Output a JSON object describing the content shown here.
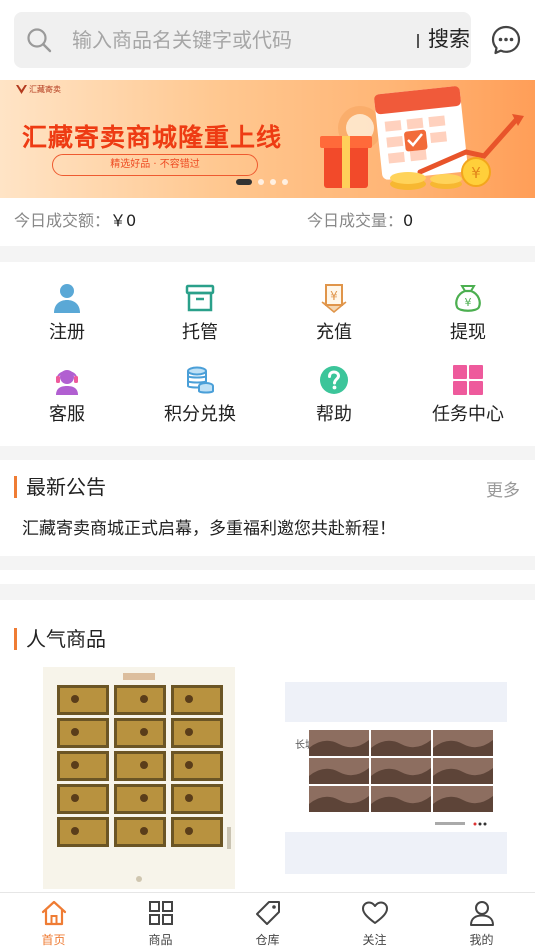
{
  "search": {
    "placeholder": "输入商品名关键字或代码",
    "button_label": "搜索",
    "icon": "search-icon",
    "message_icon": "chat-bubble-icon"
  },
  "banner": {
    "logo_text": "汇藏寄卖",
    "title": "汇藏寄卖商城隆重上线",
    "subtitle": "精选好品 · 不容错过",
    "slides_count": 4,
    "active_slide": 1
  },
  "stats": {
    "turnover_label": "今日成交额：",
    "turnover_value": "￥0",
    "volume_label": "今日成交量：",
    "volume_value": "0"
  },
  "menu": {
    "items": [
      {
        "label": "注册",
        "icon": "user-icon",
        "color": "#5aa8d6"
      },
      {
        "label": "托管",
        "icon": "archive-box-icon",
        "color": "#2aa08a"
      },
      {
        "label": "充值",
        "icon": "yen-envelope-icon",
        "color": "#e0954a"
      },
      {
        "label": "提现",
        "icon": "money-bag-icon",
        "color": "#4caf50"
      },
      {
        "label": "客服",
        "icon": "headset-agent-icon",
        "color": "#b15fd1"
      },
      {
        "label": "积分兑换",
        "icon": "coin-stack-icon",
        "color": "#4a9fd8"
      },
      {
        "label": "帮助",
        "icon": "question-circle-icon",
        "color": "#3cc59a"
      },
      {
        "label": "任务中心",
        "icon": "grid-tiles-icon",
        "color": "#ee5a9c"
      }
    ]
  },
  "notice": {
    "title": "最新公告",
    "more": "更多",
    "text": "汇藏寄卖商城正式启幕，多重福利邀您共赴新程！"
  },
  "hot": {
    "title": "人气商品",
    "items": [
      {
        "image": "stamp-sheet-figures"
      },
      {
        "image": "stamp-sheet-landscape"
      }
    ]
  },
  "tabbar": {
    "tabs": [
      {
        "label": "首页",
        "icon": "home-icon",
        "active": true
      },
      {
        "label": "商品",
        "icon": "grid-icon",
        "active": false
      },
      {
        "label": "仓库",
        "icon": "tag-icon",
        "active": false
      },
      {
        "label": "关注",
        "icon": "heart-icon",
        "active": false
      },
      {
        "label": "我的",
        "icon": "person-icon",
        "active": false
      }
    ]
  },
  "colors": {
    "accent": "#ef7c34",
    "banner_title": "#ee3b13"
  }
}
